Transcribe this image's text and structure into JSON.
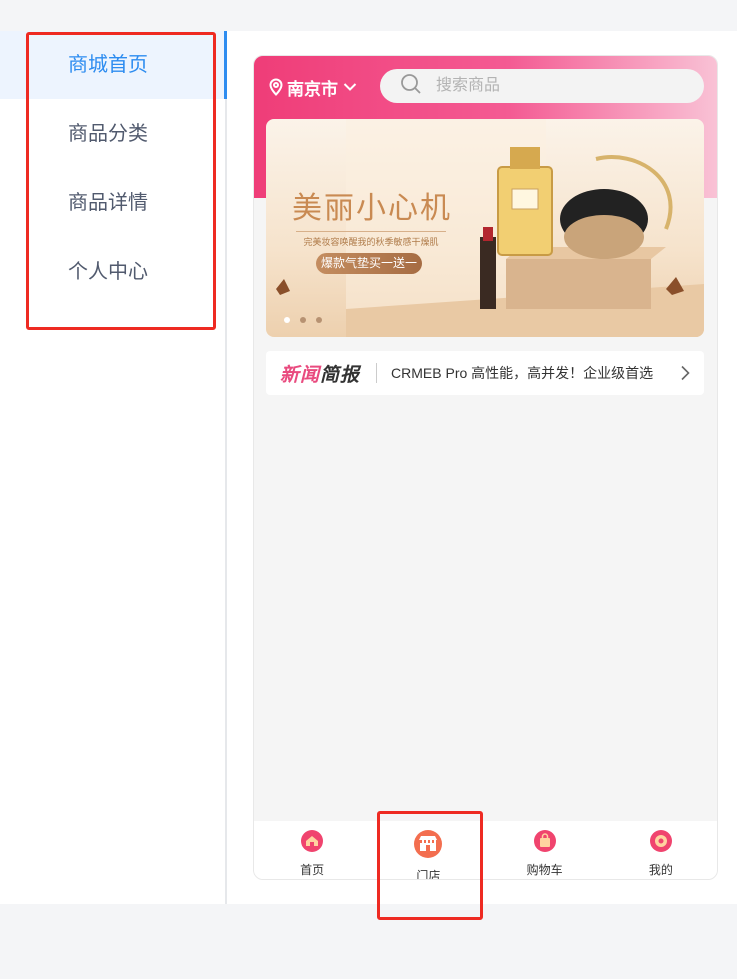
{
  "sidebar": {
    "items": [
      {
        "label": "商城首页",
        "active": true
      },
      {
        "label": "商品分类",
        "active": false
      },
      {
        "label": "商品详情",
        "active": false
      },
      {
        "label": "个人中心",
        "active": false
      }
    ]
  },
  "phone": {
    "location": "南京市",
    "search_placeholder": "搜索商品",
    "banner": {
      "title": "美丽小心机",
      "subtitle": "完美妆容唤醒我的秋季敏感干燥肌",
      "tag": "爆款气垫买一送一"
    },
    "news": {
      "logo_part1": "新闻",
      "logo_part2": "简报",
      "text": "CRMEB Pro 高性能，高并发！企业级首选"
    },
    "tabbar": [
      {
        "label": "首页",
        "icon": "home-icon"
      },
      {
        "label": "门店",
        "icon": "store-icon"
      },
      {
        "label": "购物车",
        "icon": "cart-icon"
      },
      {
        "label": "我的",
        "icon": "user-icon"
      }
    ]
  },
  "colors": {
    "accent_blue": "#2d8cf0",
    "header_pink": "#ef3d78",
    "highlight_red": "#ee2a22"
  }
}
